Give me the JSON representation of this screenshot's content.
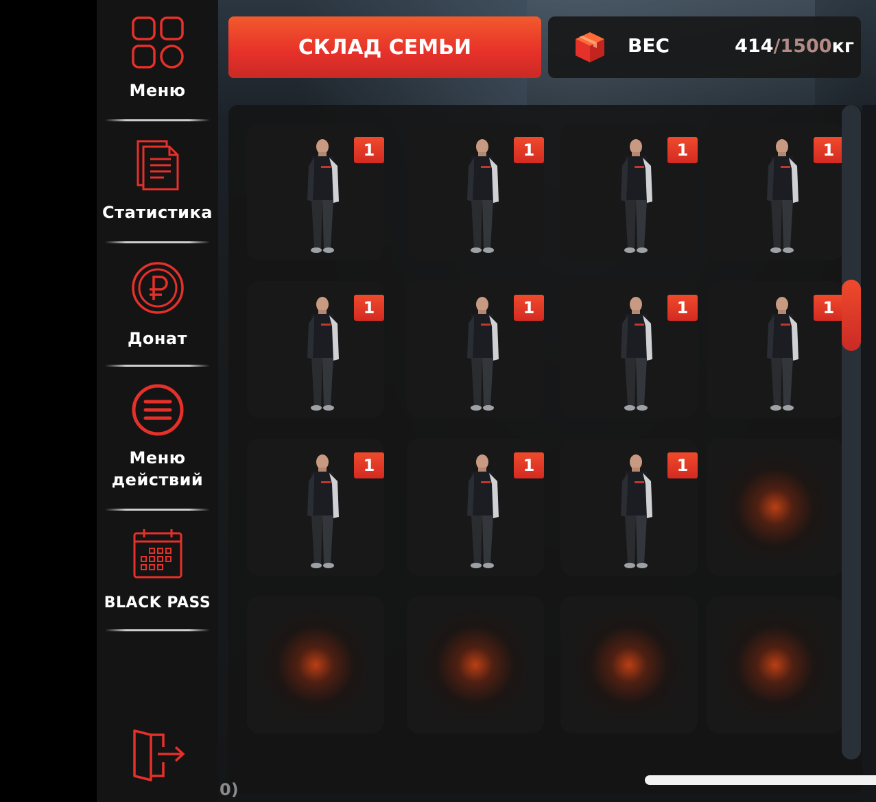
{
  "sidebar": {
    "items": [
      {
        "label": "Меню",
        "icon": "grid-menu-icon"
      },
      {
        "label": "Статистика",
        "icon": "documents-icon"
      },
      {
        "label": "Донат",
        "icon": "ruble-coin-icon"
      },
      {
        "label_line1": "Меню",
        "label_line2": "действий",
        "icon": "action-menu-icon"
      },
      {
        "label": "BLACK PASS",
        "icon": "calendar-icon"
      }
    ],
    "exit_icon": "exit-door-icon"
  },
  "header": {
    "title": "СКЛАД СЕМЬИ",
    "weight_label": "ВЕС",
    "weight_current": "414",
    "weight_max": "/1500",
    "weight_unit": "кг",
    "weight_icon": "box-icon"
  },
  "inventory": {
    "items": [
      {
        "kind": "character-skin",
        "count": "1"
      },
      {
        "kind": "character-skin",
        "count": "1"
      },
      {
        "kind": "character-skin",
        "count": "1"
      },
      {
        "kind": "character-skin",
        "count": "1"
      },
      {
        "kind": "character-skin",
        "count": "1"
      },
      {
        "kind": "character-skin",
        "count": "1"
      },
      {
        "kind": "character-skin",
        "count": "1"
      },
      {
        "kind": "character-skin",
        "count": "1"
      },
      {
        "kind": "character-skin",
        "count": "1"
      },
      {
        "kind": "character-skin",
        "count": "1"
      },
      {
        "kind": "character-skin",
        "count": "1"
      }
    ],
    "empty_slots": 5,
    "scroll_position": 0.3
  },
  "overlay": {
    "stray_text": "0)"
  },
  "colors": {
    "accent": "#e6302a",
    "accent_light": "#f25a2c",
    "sidebar_bg": "#141414",
    "panel_bg": "#181818",
    "max_weight_text": "#b28a86"
  }
}
